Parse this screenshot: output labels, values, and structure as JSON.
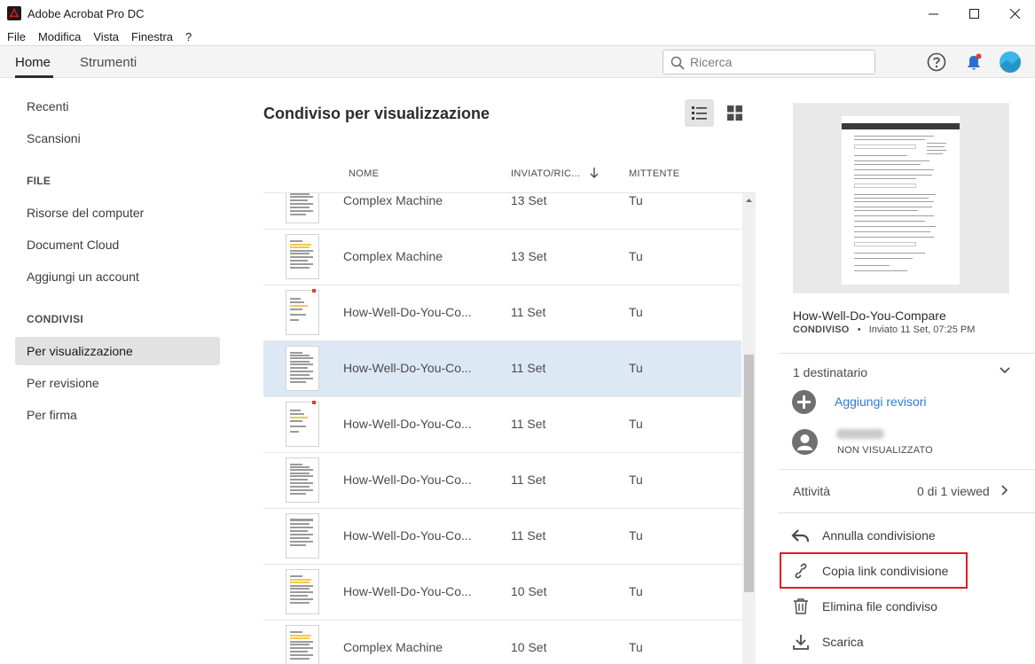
{
  "window": {
    "title": "Adobe Acrobat Pro DC"
  },
  "menu": [
    "File",
    "Modifica",
    "Vista",
    "Finestra",
    "?"
  ],
  "nav": {
    "tabs": [
      "Home",
      "Strumenti"
    ],
    "search_placeholder": "Ricerca"
  },
  "sidebar": {
    "items_top": [
      "Recenti",
      "Scansioni"
    ],
    "file_heading": "FILE",
    "file_items": [
      "Risorse del computer",
      "Document Cloud",
      "Aggiungi un account"
    ],
    "shared_heading": "CONDIVISI",
    "shared_items": [
      "Per visualizzazione",
      "Per revisione",
      "Per firma"
    ],
    "active_item": "Per visualizzazione"
  },
  "main": {
    "title": "Condiviso per visualizzazione",
    "columns": [
      "NOME",
      "INVIATO/RIC...",
      "MITTENTE"
    ],
    "rows": [
      {
        "name": "Complex Machine",
        "date": "13 Set",
        "sender": "Tu",
        "thumb": "doc"
      },
      {
        "name": "Complex Machine",
        "date": "13 Set",
        "sender": "Tu",
        "thumb": "doc-yellow"
      },
      {
        "name": "How-Well-Do-You-Co...",
        "date": "11 Set",
        "sender": "Tu",
        "thumb": "flyer"
      },
      {
        "name": "How-Well-Do-You-Co...",
        "date": "11 Set",
        "sender": "Tu",
        "thumb": "doc",
        "selected": true
      },
      {
        "name": "How-Well-Do-You-Co...",
        "date": "11 Set",
        "sender": "Tu",
        "thumb": "flyer"
      },
      {
        "name": "How-Well-Do-You-Co...",
        "date": "11 Set",
        "sender": "Tu",
        "thumb": "doc"
      },
      {
        "name": "How-Well-Do-You-Co...",
        "date": "11 Set",
        "sender": "Tu",
        "thumb": "doc-dark"
      },
      {
        "name": "How-Well-Do-You-Co...",
        "date": "10 Set",
        "sender": "Tu",
        "thumb": "doc-yellow"
      },
      {
        "name": "Complex Machine",
        "date": "10 Set",
        "sender": "Tu",
        "thumb": "doc-yellow"
      }
    ]
  },
  "details": {
    "file_name": "How-Well-Do-You-Compare",
    "status": "CONDIVISO",
    "sent": "Inviato 11 Set, 07:25 PM",
    "recipients": "1 destinatario",
    "add_reviewers": "Aggiungi revisori",
    "recipient_status": "NON VISUALIZZATO",
    "activity_label": "Attività",
    "activity_value": "0 di 1 viewed",
    "actions": [
      "Annulla condivisione",
      "Copia link condivisione",
      "Elimina file condiviso",
      "Scarica"
    ]
  },
  "colors": {
    "accent_link": "#2d7bd4",
    "selection": "#dde8f5",
    "highlight_box": "#e31b23",
    "avatar": "#3ab6e8"
  }
}
